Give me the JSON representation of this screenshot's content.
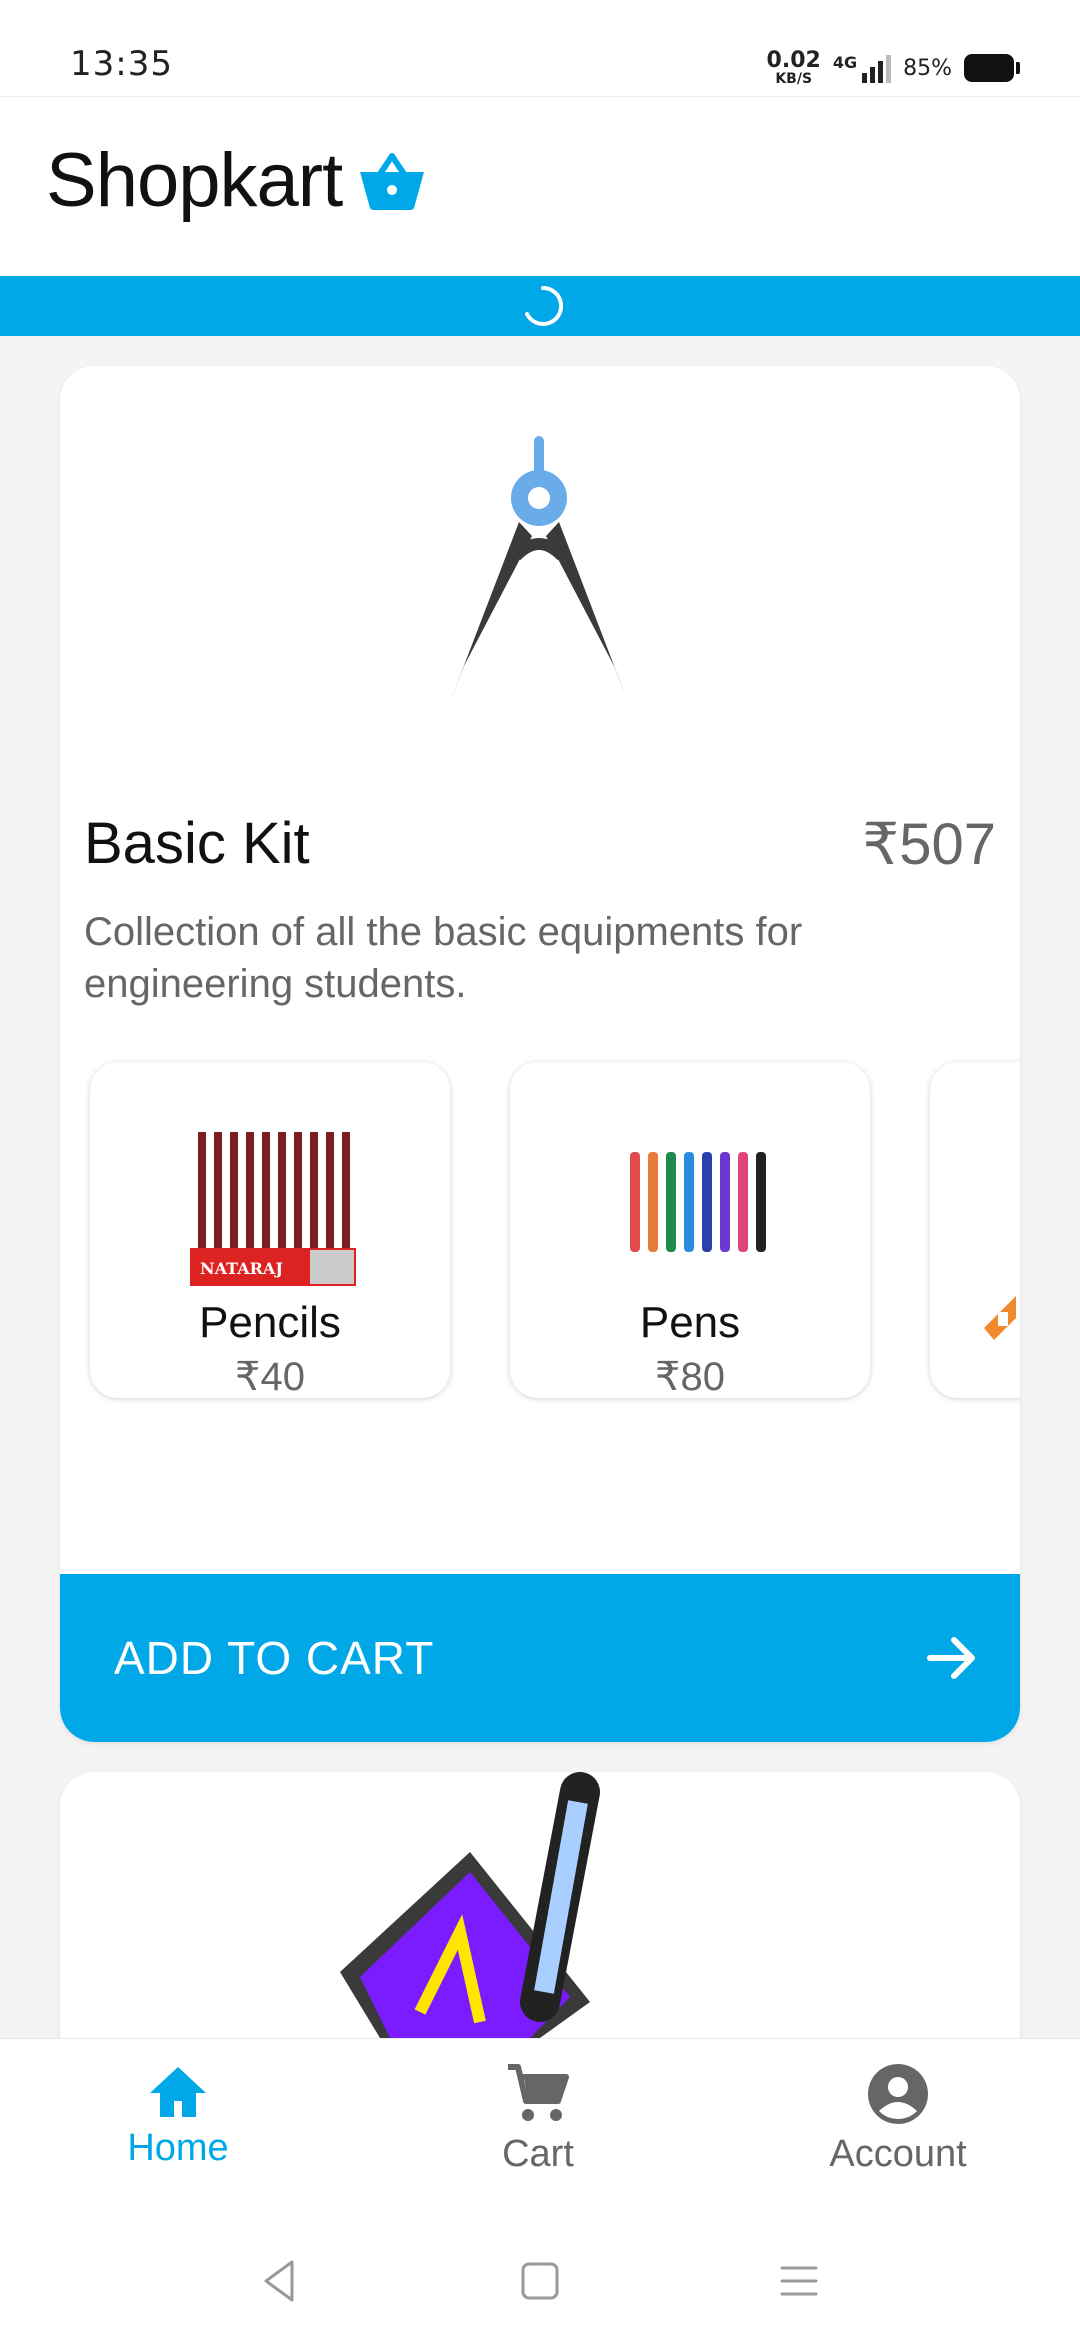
{
  "status_bar": {
    "time": "13:35",
    "net_speed_value": "0.02",
    "net_speed_unit": "KB/S",
    "network_type": "4G",
    "battery_percent": "85%"
  },
  "app": {
    "name": "Shopkart",
    "logo_icon": "shopping-basket-icon",
    "accent_color": "#00a8e8"
  },
  "product": {
    "title": "Basic Kit",
    "price": "₹507",
    "description": "Collection of all the basic equipments for engineering students.",
    "items": [
      {
        "name": "Pencils",
        "price": "₹40",
        "image": "pencils-image"
      },
      {
        "name": "Pens",
        "price": "₹80",
        "image": "pens-image"
      }
    ],
    "add_to_cart_label": "ADD TO CART"
  },
  "bottom_nav": {
    "items": [
      {
        "label": "Home",
        "icon": "home-icon",
        "active": true
      },
      {
        "label": "Cart",
        "icon": "cart-icon",
        "active": false
      },
      {
        "label": "Account",
        "icon": "account-circle-icon",
        "active": false
      }
    ]
  }
}
